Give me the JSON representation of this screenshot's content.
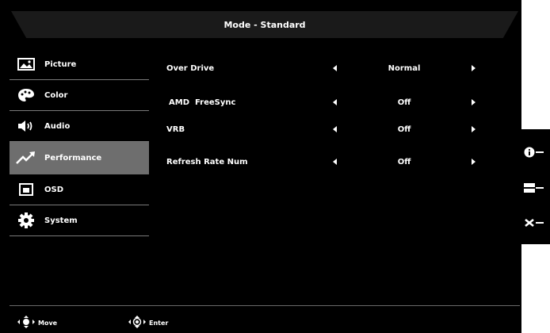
{
  "header": {
    "title": "Mode - Standard"
  },
  "menu": {
    "items": [
      {
        "label": "Picture",
        "icon": "picture-icon"
      },
      {
        "label": "Color",
        "icon": "palette-icon"
      },
      {
        "label": "Audio",
        "icon": "speaker-icon"
      },
      {
        "label": "Performance",
        "icon": "trend-arrow-icon",
        "active": true
      },
      {
        "label": "OSD",
        "icon": "osd-window-icon"
      },
      {
        "label": "System",
        "icon": "gear-icon"
      }
    ]
  },
  "settings": {
    "rows": [
      {
        "label": "Over Drive",
        "value": "Normal"
      },
      {
        "label": "AMD  FreeSync",
        "value": "Off"
      },
      {
        "label": "VRB",
        "value": "Off"
      },
      {
        "label": "Refresh Rate Num",
        "value": "Off"
      }
    ]
  },
  "footer": {
    "move_label": "Move",
    "enter_label": "Enter"
  },
  "side_buttons": {
    "items": [
      {
        "icon": "info-icon"
      },
      {
        "icon": "input-select-icon"
      },
      {
        "icon": "close-icon"
      }
    ]
  },
  "colors": {
    "background": "#000000",
    "active_item": "#6e6e6e",
    "text": "#ffffff",
    "divider": "#7a7a7a"
  }
}
